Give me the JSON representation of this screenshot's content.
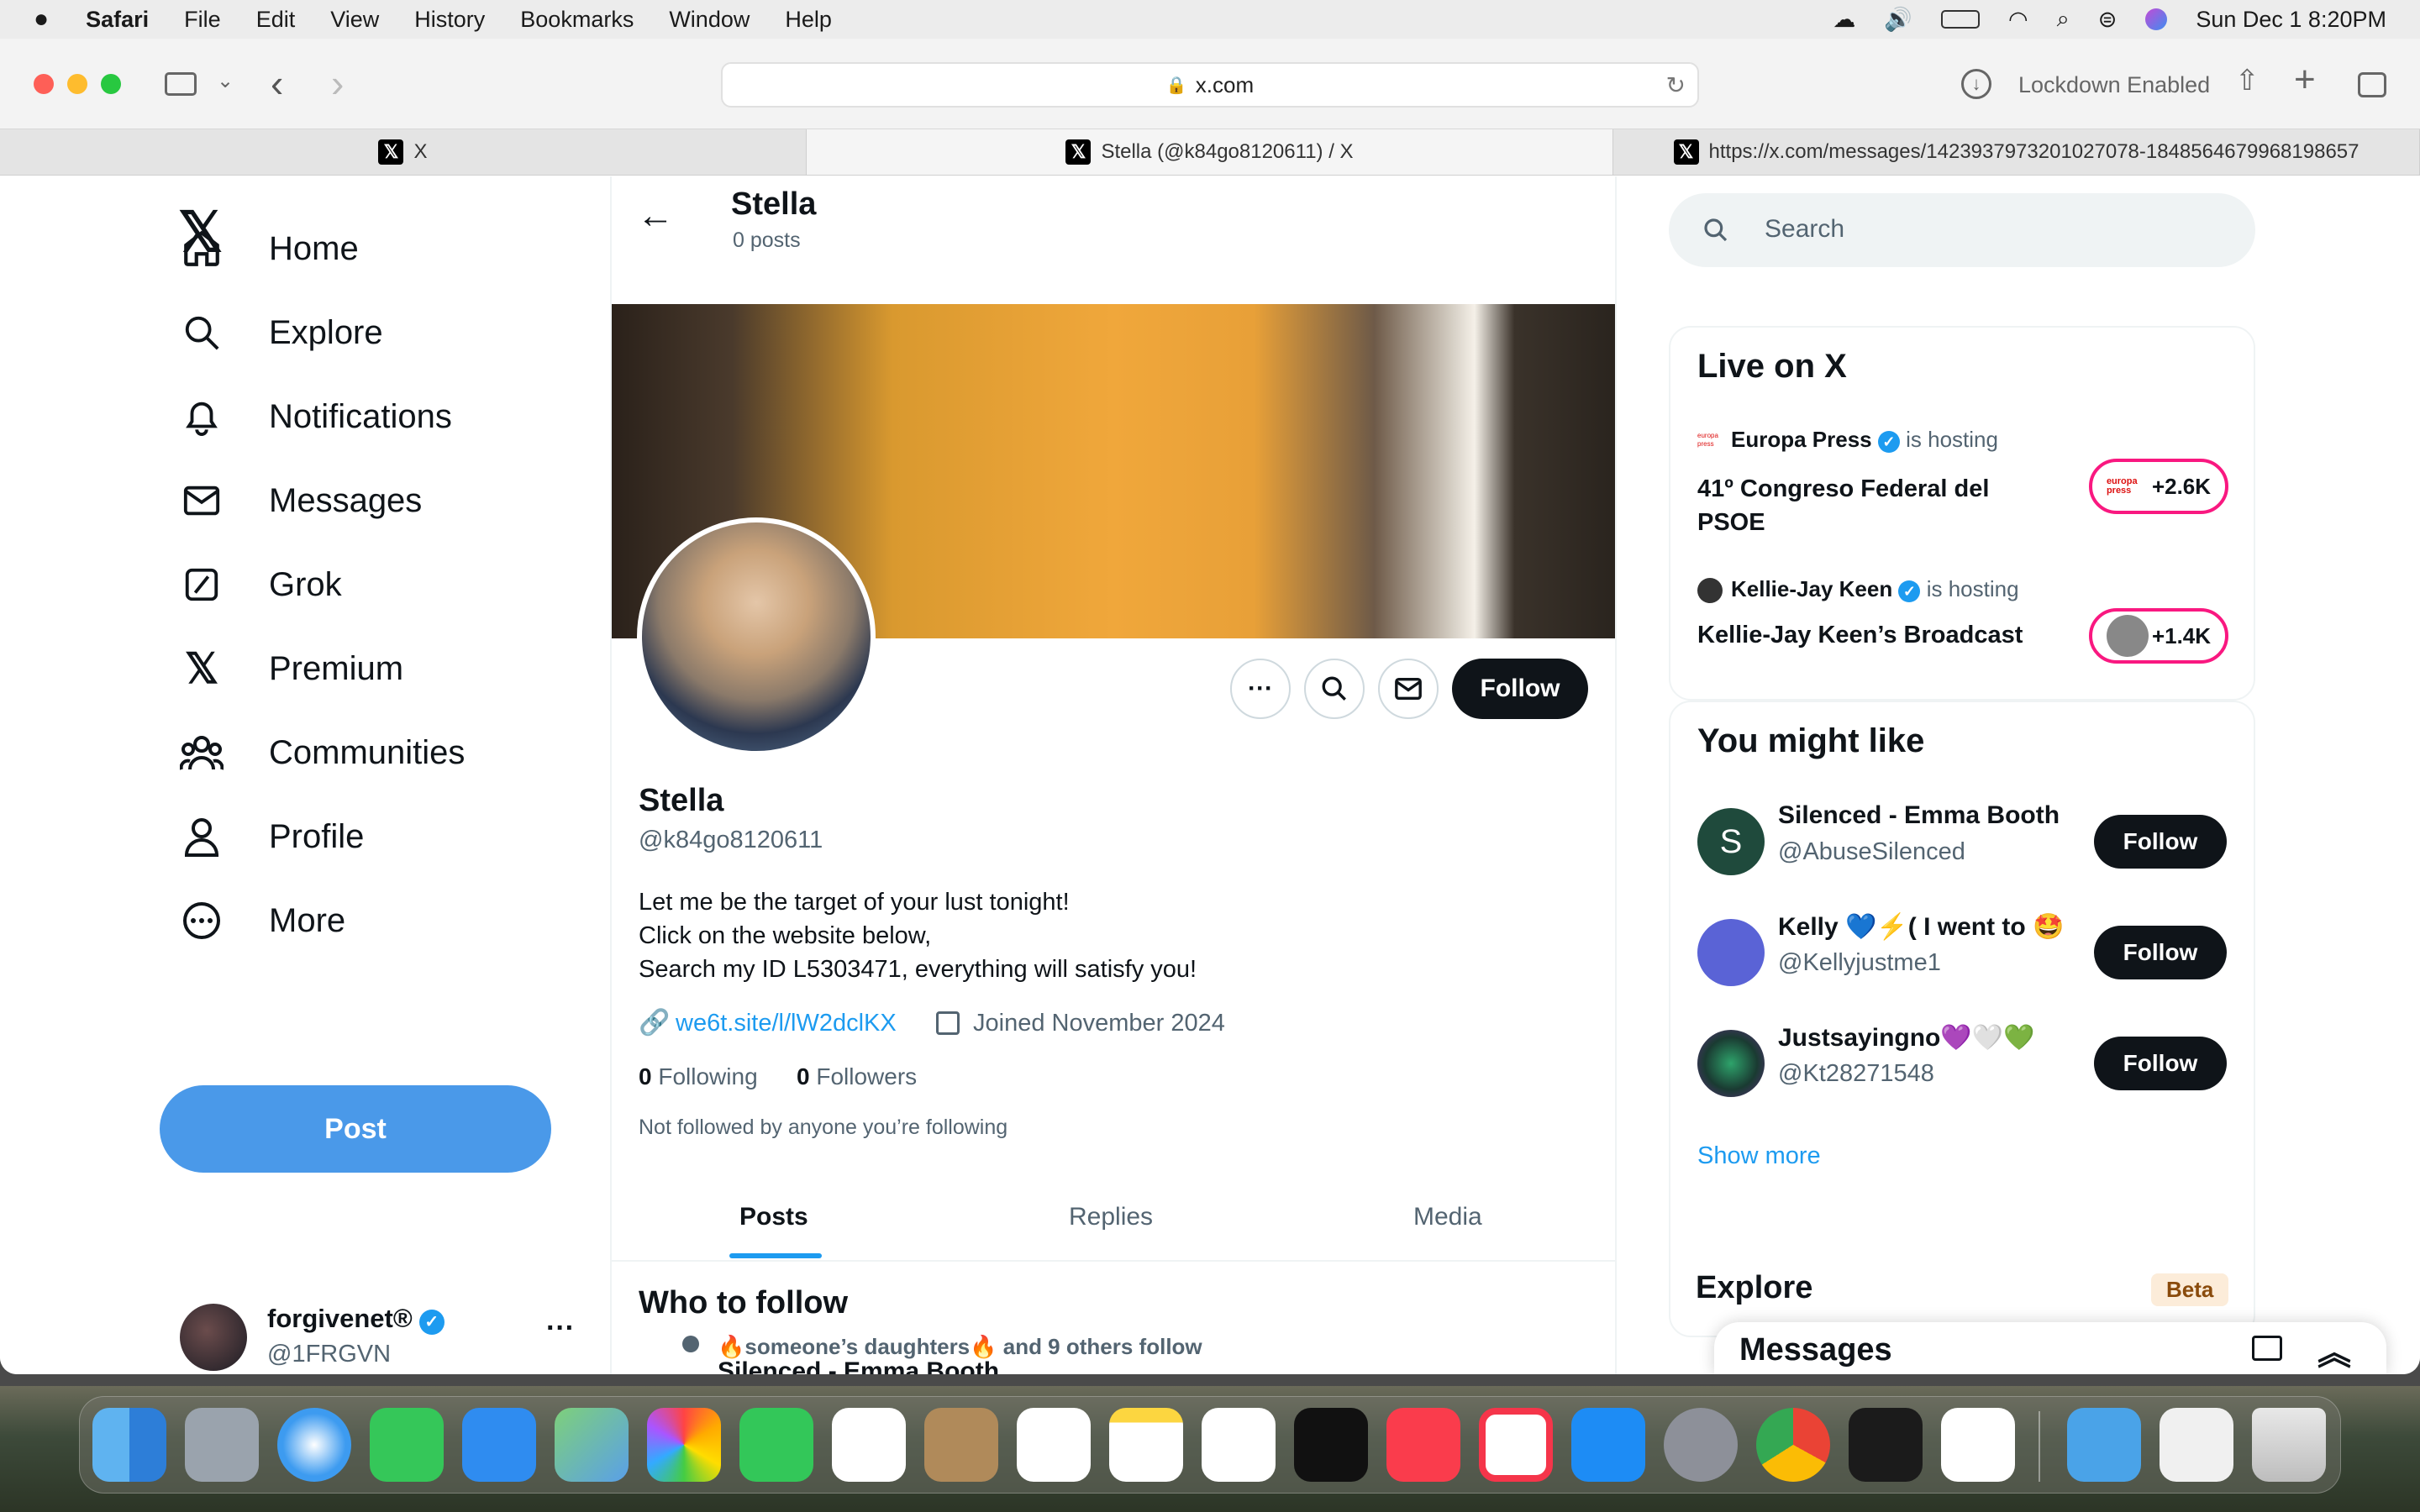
{
  "menubar": {
    "app": "Safari",
    "items": [
      "File",
      "Edit",
      "View",
      "History",
      "Bookmarks",
      "Window",
      "Help"
    ],
    "datetime": "Sun Dec 1  8:20PM"
  },
  "toolbar": {
    "url": "x.com",
    "lockdown": "Lockdown Enabled"
  },
  "tabs": [
    {
      "label": "X"
    },
    {
      "label": "Stella (@k84go8120611) / X"
    },
    {
      "label": "https://x.com/messages/1423937973201027078-1848564679968198657"
    }
  ],
  "nav": {
    "items": [
      "Home",
      "Explore",
      "Notifications",
      "Messages",
      "Grok",
      "Premium",
      "Communities",
      "Profile",
      "More"
    ],
    "post_label": "Post",
    "account_name": "forgivenet®",
    "account_handle": "@1FRGVN"
  },
  "profile": {
    "header_name": "Stella",
    "header_posts": "0 posts",
    "name": "Stella",
    "handle": "@k84go8120611",
    "bio": [
      "Let me be the target of your lust tonight!",
      "Click on the website below,",
      "Search my ID L5303471, everything will satisfy you!"
    ],
    "link": "we6t.site/l/lW2dclKX",
    "joined": "Joined November 2024",
    "following_count": "0",
    "following_label": "Following",
    "followers_count": "0",
    "followers_label": "Followers",
    "not_followed": "Not followed by anyone you’re following",
    "follow_label": "Follow",
    "tabs": [
      "Posts",
      "Replies",
      "Media"
    ],
    "who_to_follow": "Who to follow",
    "wtf_social": "🔥someone’s daughters🔥 and 9 others follow",
    "wtf_partial": "Silenced - Emma Booth"
  },
  "search": {
    "placeholder": "Search"
  },
  "live": {
    "title": "Live on X",
    "items": [
      {
        "host": "Europa Press",
        "hosting": "is hosting",
        "title": "41º Congreso Federal del PSOE",
        "count": "+2.6K",
        "badge": "europa press"
      },
      {
        "host": "Kellie-Jay Keen",
        "hosting": "is hosting",
        "title": "Kellie-Jay Keen’s Broadcast",
        "count": "+1.4K"
      }
    ]
  },
  "might_like": {
    "title": "You might like",
    "users": [
      {
        "name": "Silenced - Emma Booth",
        "handle": "@AbuseSilenced",
        "avatar_letter": "S",
        "avatar_color": "#1f4a3c"
      },
      {
        "name": "Kelly 💙⚡( I went to 🤩",
        "handle": "@Kellyjustme1",
        "avatar_color": "#5a63d6"
      },
      {
        "name": "Justsayingno💜🤍💚",
        "handle": "@Kt28271548",
        "avatar_color": "#1a3b32"
      }
    ],
    "follow_label": "Follow",
    "show_more": "Show more"
  },
  "explore": {
    "title": "Explore",
    "badge": "Beta"
  },
  "messages_drawer": {
    "title": "Messages"
  },
  "colors": {
    "accent": "#1d9bf0",
    "post": "#4a99e9",
    "live_pink": "#f91880"
  }
}
